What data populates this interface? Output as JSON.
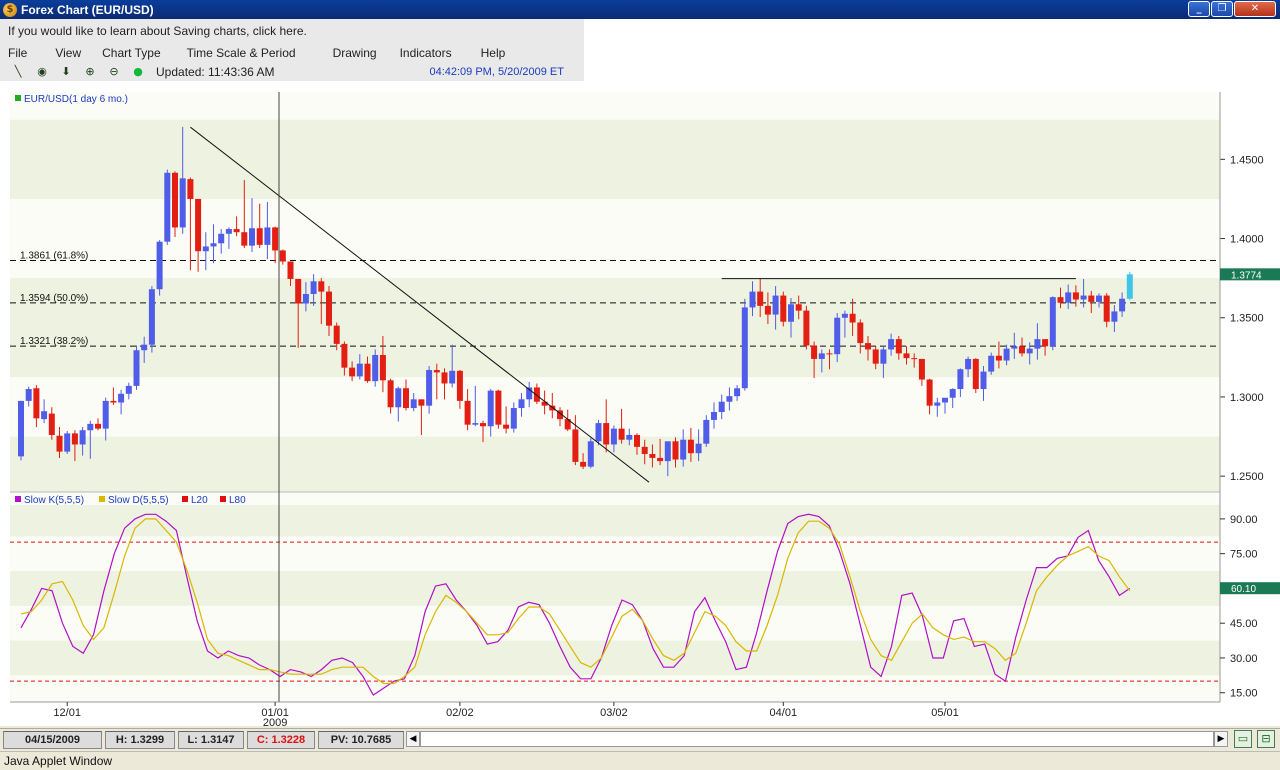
{
  "window": {
    "title": "Forex Chart (EUR/USD)",
    "buttons": {
      "minimize": "_",
      "restore": "❐",
      "close": "✕"
    }
  },
  "saving_link": "If you would like to learn about Saving charts, click here.",
  "menu": [
    "File",
    "View",
    "Chart Type",
    "Time Scale & Period",
    "Drawing",
    "Indicators",
    "Help"
  ],
  "toolbar": {
    "updated": "Updated: 11:43:36 AM",
    "datetime": "04:42:09 PM, 5/20/2009 ET",
    "icons": [
      "draw-line-icon",
      "crosshair-icon",
      "arrow-down-icon",
      "zoom-in-icon",
      "zoom-out-icon",
      "status-dot-icon"
    ]
  },
  "chart_data": [
    {
      "type": "candlestick",
      "legend": "EUR/USD(1 day 6 mo.)",
      "y_ticks": [
        "1.4500",
        "1.4000",
        "1.3500",
        "1.3000",
        "1.2500"
      ],
      "ylim": [
        1.24,
        1.4925
      ],
      "last_price": "1.3774",
      "fib_levels": [
        {
          "label": "1.3861 (61.8%)",
          "value": 1.3861
        },
        {
          "label": "1.3594 (50.0%)",
          "value": 1.3594
        },
        {
          "label": "1.3321 (38.2%)",
          "value": 1.3321
        }
      ],
      "x_ticks": [
        {
          "label": "12/01",
          "index": 6
        },
        {
          "label": "01/01",
          "sub": "2009",
          "index": 33
        },
        {
          "label": "02/02",
          "index": 57
        },
        {
          "label": "03/02",
          "index": 77
        },
        {
          "label": "04/01",
          "index": 99
        },
        {
          "label": "05/01",
          "index": 120
        }
      ],
      "trendline": {
        "from": [
          22,
          1.4703
        ],
        "to": [
          80,
          1.2525
        ]
      },
      "resistance": {
        "from": [
          91,
          1.3747
        ],
        "to": [
          137,
          1.3747
        ]
      },
      "ohlc": [
        [
          1.2625,
          1.2975,
          1.26,
          1.2975
        ],
        [
          1.2975,
          1.3065,
          1.294,
          1.305
        ],
        [
          1.3055,
          1.3075,
          1.281,
          1.2865
        ],
        [
          1.286,
          1.2985,
          1.2835,
          1.291
        ],
        [
          1.2895,
          1.2935,
          1.273,
          1.276
        ],
        [
          1.2755,
          1.281,
          1.2615,
          1.2655
        ],
        [
          1.2655,
          1.2785,
          1.264,
          1.277
        ],
        [
          1.277,
          1.279,
          1.2595,
          1.27
        ],
        [
          1.27,
          1.281,
          1.263,
          1.279
        ],
        [
          1.279,
          1.285,
          1.261,
          1.283
        ],
        [
          1.283,
          1.2865,
          1.279,
          1.28
        ],
        [
          1.28,
          1.2995,
          1.2725,
          1.2975
        ],
        [
          1.2975,
          1.306,
          1.295,
          1.2965
        ],
        [
          1.2965,
          1.3045,
          1.289,
          1.302
        ],
        [
          1.302,
          1.309,
          1.2985,
          1.307
        ],
        [
          1.307,
          1.3325,
          1.3045,
          1.3295
        ],
        [
          1.3295,
          1.338,
          1.3215,
          1.333
        ],
        [
          1.333,
          1.37,
          1.328,
          1.368
        ],
        [
          1.368,
          1.399,
          1.364,
          1.398
        ],
        [
          1.398,
          1.4435,
          1.396,
          1.4415
        ],
        [
          1.4415,
          1.4425,
          1.401,
          1.407
        ],
        [
          1.407,
          1.4705,
          1.403,
          1.438
        ],
        [
          1.4375,
          1.4385,
          1.38,
          1.425
        ],
        [
          1.425,
          1.425,
          1.379,
          1.392
        ],
        [
          1.392,
          1.404,
          1.38,
          1.395
        ],
        [
          1.395,
          1.409,
          1.3845,
          1.397
        ],
        [
          1.397,
          1.406,
          1.3905,
          1.403
        ],
        [
          1.403,
          1.407,
          1.3935,
          1.406
        ],
        [
          1.406,
          1.414,
          1.4015,
          1.404
        ],
        [
          1.404,
          1.437,
          1.394,
          1.3955
        ],
        [
          1.3955,
          1.4255,
          1.3915,
          1.4065
        ],
        [
          1.4065,
          1.422,
          1.394,
          1.396
        ],
        [
          1.396,
          1.423,
          1.387,
          1.407
        ],
        [
          1.407,
          1.4075,
          1.3845,
          1.3925
        ],
        [
          1.3925,
          1.393,
          1.3835,
          1.3855
        ],
        [
          1.3855,
          1.3855,
          1.37,
          1.3745
        ],
        [
          1.3745,
          1.3745,
          1.331,
          1.359
        ],
        [
          1.359,
          1.3725,
          1.354,
          1.365
        ],
        [
          1.365,
          1.3775,
          1.3575,
          1.373
        ],
        [
          1.373,
          1.375,
          1.346,
          1.3665
        ],
        [
          1.3665,
          1.37,
          1.3385,
          1.345
        ],
        [
          1.345,
          1.347,
          1.3295,
          1.3335
        ],
        [
          1.3335,
          1.335,
          1.3135,
          1.3185
        ],
        [
          1.3185,
          1.3225,
          1.31,
          1.313
        ],
        [
          1.313,
          1.327,
          1.311,
          1.321
        ],
        [
          1.321,
          1.3255,
          1.309,
          1.31
        ],
        [
          1.31,
          1.33,
          1.3065,
          1.3265
        ],
        [
          1.3265,
          1.3385,
          1.303,
          1.3105
        ],
        [
          1.3105,
          1.3115,
          1.2895,
          1.2935
        ],
        [
          1.2935,
          1.3065,
          1.2845,
          1.3055
        ],
        [
          1.3055,
          1.311,
          1.2915,
          1.293
        ],
        [
          1.293,
          1.3025,
          1.291,
          1.2985
        ],
        [
          1.2985,
          1.2985,
          1.276,
          1.2945
        ],
        [
          1.2945,
          1.3195,
          1.2895,
          1.317
        ],
        [
          1.317,
          1.321,
          1.2985,
          1.3155
        ],
        [
          1.3155,
          1.318,
          1.2985,
          1.3085
        ],
        [
          1.3085,
          1.333,
          1.306,
          1.3165
        ],
        [
          1.3165,
          1.317,
          1.2925,
          1.2975
        ],
        [
          1.2975,
          1.305,
          1.279,
          1.2825
        ],
        [
          1.2825,
          1.307,
          1.2815,
          1.2835
        ],
        [
          1.2835,
          1.285,
          1.2715,
          1.2815
        ],
        [
          1.2815,
          1.305,
          1.275,
          1.304
        ],
        [
          1.304,
          1.3045,
          1.28,
          1.2825
        ],
        [
          1.2825,
          1.294,
          1.277,
          1.28
        ],
        [
          1.28,
          1.2965,
          1.2775,
          1.293
        ],
        [
          1.293,
          1.3025,
          1.2875,
          1.2985
        ],
        [
          1.2985,
          1.3095,
          1.2935,
          1.306
        ],
        [
          1.306,
          1.3085,
          1.2955,
          1.297
        ],
        [
          1.297,
          1.304,
          1.289,
          1.2945
        ],
        [
          1.2945,
          1.3025,
          1.2865,
          1.2915
        ],
        [
          1.2915,
          1.2935,
          1.2815,
          1.286
        ],
        [
          1.286,
          1.292,
          1.2785,
          1.2795
        ],
        [
          1.2795,
          1.2885,
          1.257,
          1.259
        ],
        [
          1.259,
          1.2645,
          1.2545,
          1.256
        ],
        [
          1.256,
          1.274,
          1.255,
          1.272
        ],
        [
          1.272,
          1.2855,
          1.2695,
          1.2835
        ],
        [
          1.2835,
          1.2985,
          1.265,
          1.27
        ],
        [
          1.27,
          1.282,
          1.265,
          1.28
        ],
        [
          1.28,
          1.2925,
          1.2705,
          1.273
        ],
        [
          1.273,
          1.28,
          1.2695,
          1.276
        ],
        [
          1.276,
          1.277,
          1.2635,
          1.2685
        ],
        [
          1.2685,
          1.273,
          1.2575,
          1.264
        ],
        [
          1.264,
          1.27,
          1.2555,
          1.2615
        ],
        [
          1.2615,
          1.2735,
          1.257,
          1.2595
        ],
        [
          1.2595,
          1.271,
          1.25,
          1.272
        ],
        [
          1.272,
          1.2745,
          1.2555,
          1.2605
        ],
        [
          1.2605,
          1.2795,
          1.256,
          1.273
        ],
        [
          1.273,
          1.2805,
          1.259,
          1.2645
        ],
        [
          1.2645,
          1.2795,
          1.2595,
          1.2705
        ],
        [
          1.2705,
          1.2885,
          1.2685,
          1.2855
        ],
        [
          1.2855,
          1.2965,
          1.28,
          1.2905
        ],
        [
          1.2905,
          1.3015,
          1.286,
          1.297
        ],
        [
          1.297,
          1.306,
          1.2915,
          1.3005
        ],
        [
          1.3005,
          1.3075,
          1.2975,
          1.3055
        ],
        [
          1.3055,
          1.362,
          1.304,
          1.3565
        ],
        [
          1.3565,
          1.373,
          1.351,
          1.3665
        ],
        [
          1.3665,
          1.3745,
          1.3505,
          1.3575
        ],
        [
          1.3575,
          1.366,
          1.346,
          1.352
        ],
        [
          1.352,
          1.37,
          1.3425,
          1.364
        ],
        [
          1.364,
          1.3665,
          1.3445,
          1.3475
        ],
        [
          1.3475,
          1.3625,
          1.3375,
          1.3585
        ],
        [
          1.3585,
          1.364,
          1.349,
          1.3545
        ],
        [
          1.3545,
          1.3575,
          1.33,
          1.3325
        ],
        [
          1.3325,
          1.335,
          1.312,
          1.324
        ],
        [
          1.324,
          1.33,
          1.3155,
          1.3275
        ],
        [
          1.3275,
          1.33,
          1.3175,
          1.327
        ],
        [
          1.327,
          1.353,
          1.322,
          1.35
        ],
        [
          1.35,
          1.3545,
          1.3375,
          1.3525
        ],
        [
          1.3525,
          1.362,
          1.3385,
          1.347
        ],
        [
          1.347,
          1.349,
          1.3275,
          1.334
        ],
        [
          1.334,
          1.3385,
          1.323,
          1.33
        ],
        [
          1.33,
          1.332,
          1.3175,
          1.321
        ],
        [
          1.321,
          1.3325,
          1.312,
          1.33
        ],
        [
          1.33,
          1.34,
          1.326,
          1.3365
        ],
        [
          1.3365,
          1.3385,
          1.3235,
          1.3275
        ],
        [
          1.3275,
          1.332,
          1.3205,
          1.3245
        ],
        [
          1.3245,
          1.3275,
          1.3185,
          1.324
        ],
        [
          1.324,
          1.324,
          1.307,
          1.311
        ],
        [
          1.311,
          1.3115,
          1.289,
          1.2945
        ],
        [
          1.2945,
          1.2995,
          1.2875,
          1.2965
        ],
        [
          1.2965,
          1.299,
          1.2895,
          1.2995
        ],
        [
          1.2995,
          1.3055,
          1.293,
          1.305
        ],
        [
          1.305,
          1.318,
          1.3,
          1.3175
        ],
        [
          1.3175,
          1.3255,
          1.3125,
          1.324
        ],
        [
          1.324,
          1.3245,
          1.3025,
          1.305
        ],
        [
          1.305,
          1.3195,
          1.2975,
          1.316
        ],
        [
          1.316,
          1.328,
          1.314,
          1.326
        ],
        [
          1.326,
          1.335,
          1.318,
          1.323
        ],
        [
          1.323,
          1.333,
          1.32,
          1.3305
        ],
        [
          1.3305,
          1.3405,
          1.324,
          1.332
        ],
        [
          1.332,
          1.3375,
          1.3255,
          1.3275
        ],
        [
          1.3275,
          1.3345,
          1.3205,
          1.3305
        ],
        [
          1.3305,
          1.3465,
          1.3235,
          1.3365
        ],
        [
          1.3365,
          1.3365,
          1.326,
          1.332
        ],
        [
          1.332,
          1.3635,
          1.3295,
          1.363
        ],
        [
          1.363,
          1.369,
          1.356,
          1.3595
        ],
        [
          1.3595,
          1.371,
          1.3555,
          1.366
        ],
        [
          1.366,
          1.3705,
          1.357,
          1.3615
        ],
        [
          1.3615,
          1.3745,
          1.3565,
          1.364
        ],
        [
          1.364,
          1.367,
          1.353,
          1.36
        ],
        [
          1.36,
          1.3655,
          1.3565,
          1.364
        ],
        [
          1.364,
          1.3655,
          1.344,
          1.3475
        ],
        [
          1.3475,
          1.358,
          1.341,
          1.354
        ],
        [
          1.354,
          1.366,
          1.3505,
          1.362
        ],
        [
          1.362,
          1.379,
          1.361,
          1.3774
        ]
      ]
    },
    {
      "type": "line",
      "legend": [
        {
          "name": "Slow K(5,5,5)",
          "color": "#b010c8"
        },
        {
          "name": "Slow D(5,5,5)",
          "color": "#d8b800"
        },
        {
          "name": "L20",
          "color": "#e01010"
        },
        {
          "name": "L80",
          "color": "#e01010"
        }
      ],
      "y_ticks": [
        "90.00",
        "75.00",
        "45.00",
        "30.00",
        "15.00"
      ],
      "ylim": [
        11,
        96
      ],
      "levels": [
        20,
        80
      ],
      "last_value": "60.10",
      "series": [
        {
          "name": "Slow K(5,5,5)",
          "values": [
            43,
            51,
            60,
            59,
            45,
            35,
            32,
            40,
            59,
            75,
            86,
            90,
            92,
            92,
            89,
            85,
            65,
            46,
            33,
            30,
            33,
            31,
            30,
            27,
            25,
            22,
            25,
            24,
            22,
            25,
            29,
            30,
            28,
            22,
            14,
            17,
            20,
            21,
            31,
            50,
            61,
            62,
            55,
            50,
            44,
            36,
            37,
            42,
            52,
            54,
            53,
            45,
            35,
            26,
            21,
            21,
            30,
            44,
            55,
            53,
            46,
            34,
            26,
            26,
            31,
            50,
            56,
            46,
            37,
            25,
            26,
            41,
            59,
            76,
            88,
            91,
            92,
            91,
            87,
            76,
            62,
            44,
            26,
            22,
            35,
            57,
            58,
            48,
            30,
            30,
            46,
            47,
            35,
            36,
            23,
            20,
            39,
            55,
            69,
            69,
            73,
            74,
            82,
            85,
            72,
            65,
            57,
            60
          ]
        },
        {
          "name": "Slow D(5,5,5)",
          "values": [
            49,
            50,
            55,
            62,
            63,
            55,
            44,
            38,
            43,
            58,
            74,
            86,
            90,
            90,
            85,
            80,
            68,
            54,
            38,
            32,
            31,
            29,
            27,
            25,
            25,
            24,
            23,
            23,
            23,
            23,
            25,
            26,
            26,
            26,
            22,
            19,
            19,
            22,
            26,
            40,
            50,
            57,
            54,
            50,
            45,
            40,
            40,
            41,
            47,
            52,
            52,
            49,
            42,
            35,
            28,
            26,
            30,
            39,
            48,
            51,
            46,
            38,
            31,
            29,
            32,
            41,
            50,
            48,
            44,
            37,
            33,
            33,
            44,
            57,
            73,
            84,
            89,
            89,
            86,
            79,
            65,
            50,
            38,
            31,
            29,
            37,
            45,
            49,
            43,
            40,
            38,
            39,
            37,
            37,
            34,
            29,
            32,
            45,
            59,
            65,
            70,
            74,
            76,
            78,
            74,
            72,
            65,
            59
          ]
        }
      ]
    }
  ],
  "status": {
    "date": "04/15/2009",
    "high": "H: 1.3299",
    "low": "L: 1.3147",
    "close": "C: 1.3228",
    "pv": "PV: 10.7685"
  },
  "scroll_arrows": {
    "left": "◀",
    "right": "▶"
  },
  "layout_buttons": {
    "single": "▭",
    "split": "⊟"
  },
  "footer": "Java Applet Window",
  "colors": {
    "up_candle": "#4f5de8",
    "down_candle": "#e31e12",
    "last_candle": "#3ec6e8",
    "price_tag": "#1a7a56",
    "band": "#eef2e0"
  }
}
